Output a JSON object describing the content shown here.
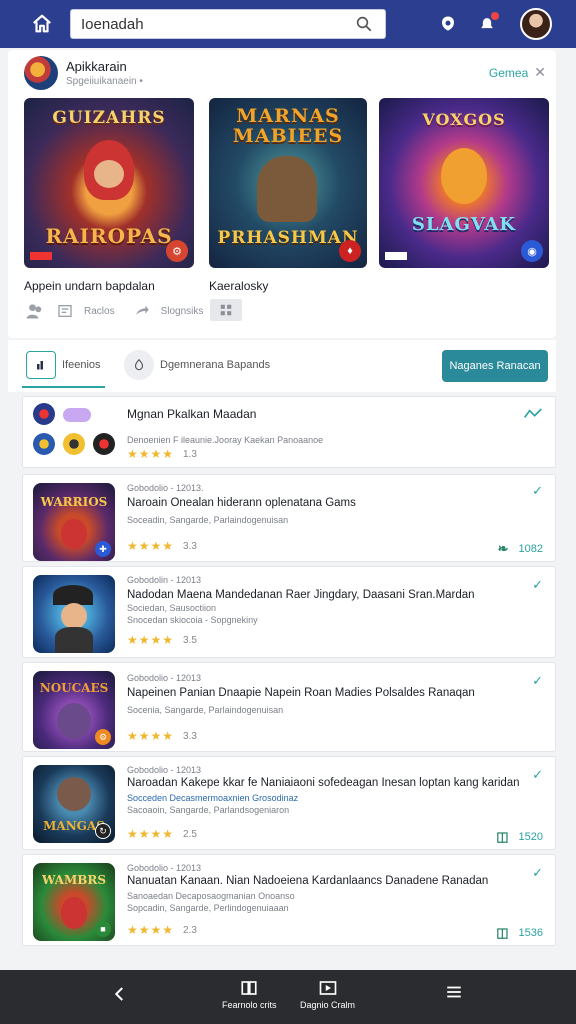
{
  "topbar": {
    "search_value": "Ioenadah",
    "icons": [
      "home-icon",
      "search-icon",
      "messages-icon",
      "notifications-icon"
    ]
  },
  "featured": {
    "title": "Apikkarain",
    "subtitle": "Spgeiiuikanaein •",
    "games_link": "Gemea",
    "art": [
      {
        "title": "GUIZAHRS",
        "subtitle": "RAIROPAS"
      },
      {
        "title": "MARNAS MABIEES",
        "subtitle": "PRHASHMAN"
      },
      {
        "title": "VOXGOS",
        "subtitle": "SLAGVAK"
      }
    ],
    "captions": [
      "Appein undarn bapdalan",
      "Kaeralosky"
    ],
    "actions": [
      "Raclos",
      "Slognsiks"
    ]
  },
  "tabs": {
    "tab1": "Ifeenios",
    "tab2": "Dgemnerana Bapands",
    "primary_button": "Naganes Ranacan"
  },
  "list": [
    {
      "title": "Mgnan Pkalkan Maadan",
      "meta": "Denoenien F ileaunie.Jooray Kaekan Panoaanoe",
      "rating": "1.3"
    },
    {
      "meta_top": "Gobodolio - 12013.",
      "title": "Naroain Onealan hiderann oplenatana Gams",
      "meta": "Soceadin, Sangarde, Parlaindogenuisan",
      "rating": "3.3",
      "count": "1082"
    },
    {
      "meta_top": "Gobodolin - 12013",
      "title": "Nadodan Maena Mandedanan Raer Jingdary, Daasani Sran.Mardan",
      "meta": "Sociedan, Sausoctiion",
      "meta2": "Snocedan skiocoia - Sopgnekiny",
      "rating": "3.5"
    },
    {
      "meta_top": "Gobodolio - 12013",
      "title": "Napeinen Panian Dnaapie Napein Roan Madies Polsaldes Ranaqan",
      "meta": "Socenia, Sangarde, Parlaindogenuisan",
      "rating": "3.3"
    },
    {
      "meta_top": "Gobodolio - 12013",
      "title": "Naroadan Kakepe kkar fe Naniaiaoni sofedeagan Inesan loptan kang karidan",
      "meta": "Socceden Decasmermoaxnien Grosodinaz",
      "meta2": "Sacoaoin, Sangarde, Parlandsogeniaron",
      "rating": "2.5",
      "count": "1520"
    },
    {
      "meta_top": "Gobodolio - 12013",
      "title": "Nanuatan Kanaan. Nian Nadoeiena Kardanlaancs Danadene Ranadan",
      "meta": "Sanoaedan Decaposaogmanian Onoanso",
      "meta2": "Sopcadin, Sangarde, Perlindogenuiaaan",
      "rating": "2.3",
      "count": "1536"
    }
  ],
  "bottomnav": {
    "item2": "Fearnolo crits",
    "item3": "Dagnio Cralm"
  },
  "colors": {
    "topbar": "#2c3e8f",
    "accent": "#2aa3a3",
    "button": "#2a8a9a",
    "stars": "#f0b72f",
    "bottomnav": "#2b2c2f"
  }
}
